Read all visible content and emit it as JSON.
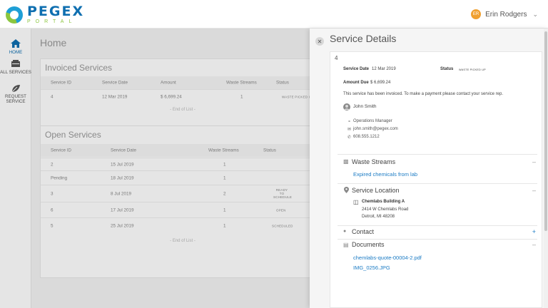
{
  "header": {
    "logo_top": "PEGEX",
    "logo_bottom": "PORTAL",
    "user_initials": "ER",
    "user_name": "Erin Rodgers"
  },
  "sidebar": {
    "items": [
      {
        "label": "HOME",
        "icon": "home-icon"
      },
      {
        "label": "ALL SERVICES",
        "icon": "truck-icon"
      },
      {
        "label": "REQUEST SERVICE",
        "icon": "leaf-icon"
      }
    ]
  },
  "main": {
    "title": "Home",
    "invoiced": {
      "title": "Invoiced Services",
      "columns": [
        "Service ID",
        "Service Date",
        "Amount",
        "Waste Streams",
        "Status"
      ],
      "rows": [
        {
          "id": "4",
          "date": "12 Mar 2019",
          "amount": "$ 6,699.24",
          "streams": "1",
          "status": "WASTE PICKED UP"
        }
      ],
      "end": "- End of List -"
    },
    "open": {
      "title": "Open Services",
      "columns": [
        "Service ID",
        "Service Date",
        "Waste Streams",
        "Status"
      ],
      "rows": [
        {
          "id": "2",
          "date": "15 Jul 2019",
          "streams": "1",
          "status": ""
        },
        {
          "id": "Pending",
          "date": "18 Jul 2019",
          "streams": "1",
          "status": ""
        },
        {
          "id": "3",
          "date": "8 Jul 2019",
          "streams": "2",
          "status": "READY TO SCHEDULE"
        },
        {
          "id": "6",
          "date": "17 Jul 2019",
          "streams": "1",
          "status": "OPEN"
        },
        {
          "id": "5",
          "date": "25 Jul 2019",
          "streams": "1",
          "status": "SCHEDULED"
        }
      ],
      "end": "- End of List -"
    }
  },
  "panel": {
    "title": "Service Details",
    "service_id": "4",
    "service_date_label": "Service Date",
    "service_date": "12 Mar 2019",
    "status_label": "Status",
    "status": "WASTE PICKED UP",
    "amount_label": "Amount Due",
    "amount": "$ 6,699.24",
    "note": "This service has been invoiced. To make a payment please contact your service rep.",
    "rep": {
      "name": "John Smith",
      "title": "Operations Manager",
      "email": "john.smith@pegex.com",
      "phone": "608.555.1212"
    },
    "waste_streams": {
      "title": "Waste Streams",
      "toggle": "–",
      "items": [
        "Expired chemicals from lab"
      ]
    },
    "location": {
      "title": "Service Location",
      "toggle": "–",
      "name": "Chemlabs Building A",
      "address1": "2414 W Chemlabs Road",
      "address2": "Detroit, MI 48208"
    },
    "contact": {
      "title": "Contact",
      "toggle": "+"
    },
    "documents": {
      "title": "Documents",
      "toggle": "–",
      "items": [
        "chemlabs-quote-00004-2.pdf",
        "IMG_0256.JPG"
      ]
    }
  },
  "colors": {
    "brand_blue": "#0f6fb0",
    "brand_green": "#8cc63f",
    "link": "#1b7bc4",
    "avatar": "#f0a030"
  }
}
